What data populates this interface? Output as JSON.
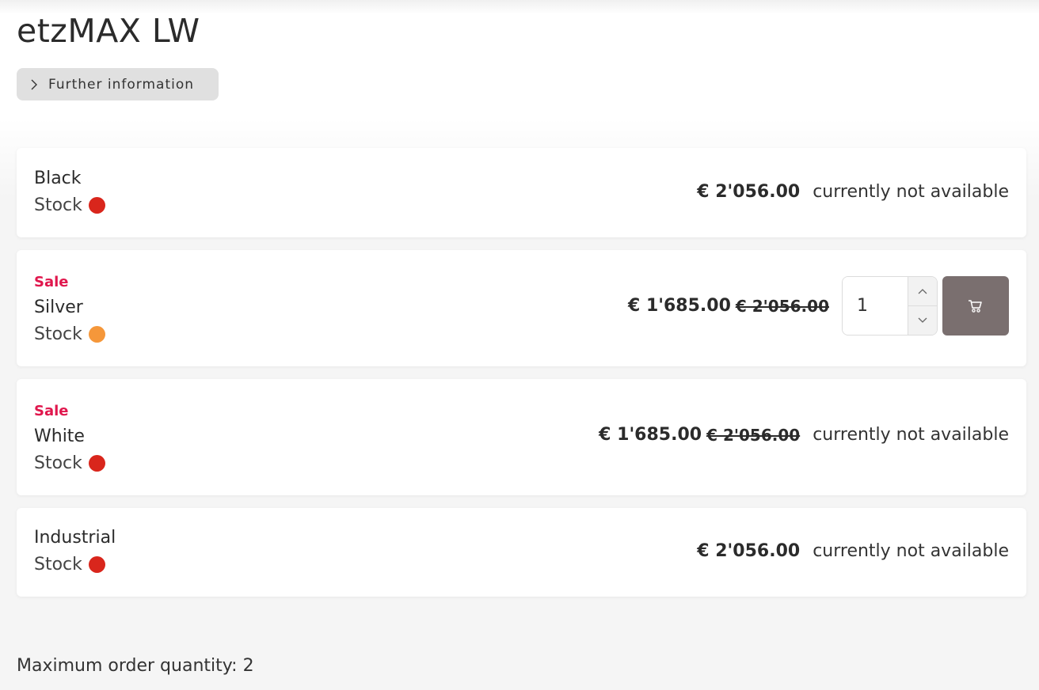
{
  "product": {
    "title": "etzMAX LW",
    "info_button": "Further information"
  },
  "variants": [
    {
      "name": "Black",
      "sale": "",
      "stock_label": "Stock",
      "stock_color": "#d9261c",
      "price": "€ 2'056.00",
      "old_price": "",
      "availability": "currently not available"
    },
    {
      "name": "Silver",
      "sale": "Sale",
      "stock_label": "Stock",
      "stock_color": "#f5973a",
      "price": "€ 1'685.00",
      "old_price": "€ 2'056.00",
      "quantity": "1",
      "cart_icon": "cart-icon"
    },
    {
      "name": "White",
      "sale": "Sale",
      "stock_label": "Stock",
      "stock_color": "#d9261c",
      "price": "€ 1'685.00",
      "old_price": "€ 2'056.00",
      "availability": "currently not available"
    },
    {
      "name": "Industrial",
      "sale": "",
      "stock_label": "Stock",
      "stock_color": "#d9261c",
      "price": "€ 2'056.00",
      "old_price": "",
      "availability": "currently not available"
    }
  ],
  "footer": {
    "max_order": "Maximum order quantity: 2"
  },
  "colors": {
    "sale": "#e0174d",
    "cart_button": "#7a6f6f"
  }
}
